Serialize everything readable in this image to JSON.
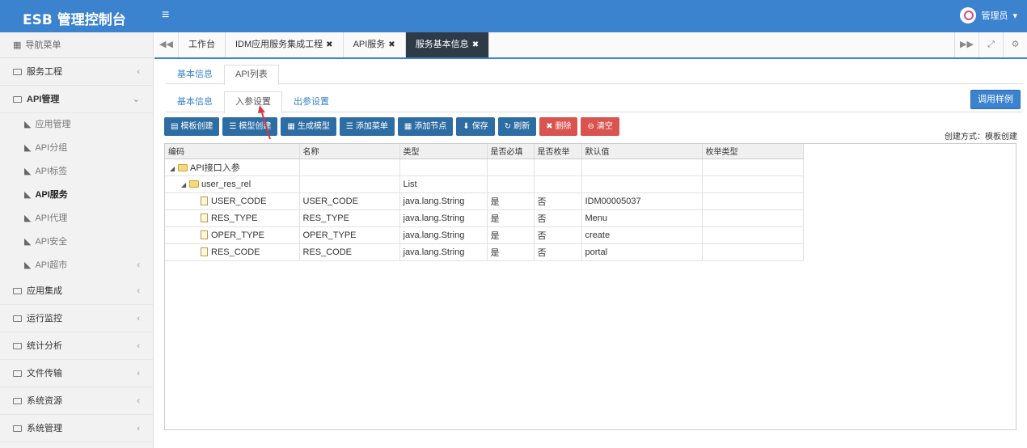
{
  "header": {
    "title": "ESB 管理控制台",
    "menu_icon": "hamburger-icon",
    "user_name": "管理员",
    "accent_color": "#3b82cf"
  },
  "sidebar": {
    "nav_title": "导航菜单",
    "groups": [
      {
        "label": "服务工程",
        "arrow": "‹"
      },
      {
        "label": "API管理",
        "arrow": "⌄",
        "open": true
      },
      {
        "label": "应用集成",
        "arrow": "‹"
      },
      {
        "label": "运行监控",
        "arrow": "‹"
      },
      {
        "label": "统计分析",
        "arrow": "‹"
      },
      {
        "label": "文件传输",
        "arrow": "‹"
      },
      {
        "label": "系统资源",
        "arrow": "‹"
      },
      {
        "label": "系统管理",
        "arrow": "‹"
      }
    ],
    "api_items": [
      {
        "label": "应用管理"
      },
      {
        "label": "API分组"
      },
      {
        "label": "API标签"
      },
      {
        "label": "API服务",
        "active": true
      },
      {
        "label": "API代理"
      },
      {
        "label": "API安全"
      },
      {
        "label": "API超市",
        "arrow": "‹"
      }
    ]
  },
  "page_tabs": [
    {
      "label": "工作台",
      "closable": false
    },
    {
      "label": "IDM应用服务集成工程",
      "closable": true
    },
    {
      "label": "API服务",
      "closable": true
    },
    {
      "label": "服务基本信息",
      "closable": true,
      "active": true
    }
  ],
  "tab_nav": {
    "prev": "◀◀",
    "next": "▶▶",
    "full": "⤢",
    "settings": "⚙"
  },
  "sub_tabs": [
    {
      "label": "基本信息"
    },
    {
      "label": "API列表",
      "active": true
    }
  ],
  "param_tabs": [
    {
      "label": "基本信息"
    },
    {
      "label": "入参设置",
      "active": true
    },
    {
      "label": "出参设置"
    }
  ],
  "example_button": "调用样例",
  "toolbar": [
    {
      "label": "模板创建",
      "icon": "▤",
      "color": "blue"
    },
    {
      "label": "模型创建",
      "icon": "☰",
      "color": "blue"
    },
    {
      "label": "生成模型",
      "icon": "▦",
      "color": "blue"
    },
    {
      "label": "添加菜单",
      "icon": "☰",
      "color": "blue"
    },
    {
      "label": "添加节点",
      "icon": "▦",
      "color": "blue"
    },
    {
      "label": "保存",
      "icon": "⬇",
      "color": "blue"
    },
    {
      "label": "刷新",
      "icon": "↻",
      "color": "blue"
    },
    {
      "label": "删除",
      "icon": "✖",
      "color": "red"
    },
    {
      "label": "清空",
      "icon": "⊖",
      "color": "red"
    }
  ],
  "create_mode": "创建方式：模板创建",
  "grid": {
    "columns": [
      "编码",
      "名称",
      "类型",
      "是否必填",
      "是否枚举",
      "默认值",
      "枚举类型"
    ],
    "rows": [
      {
        "level": 0,
        "kind": "folder",
        "expanded": true,
        "cells": [
          "API接口入参",
          "",
          "",
          "",
          "",
          "",
          ""
        ]
      },
      {
        "level": 1,
        "kind": "folder",
        "expanded": true,
        "cells": [
          "user_res_rel",
          "",
          "List",
          "",
          "",
          "",
          ""
        ]
      },
      {
        "level": 2,
        "kind": "file",
        "cells": [
          "USER_CODE",
          "USER_CODE",
          "java.lang.String",
          "是",
          "否",
          "IDM00005037",
          ""
        ]
      },
      {
        "level": 2,
        "kind": "file",
        "cells": [
          "RES_TYPE",
          "RES_TYPE",
          "java.lang.String",
          "是",
          "否",
          "Menu",
          ""
        ]
      },
      {
        "level": 2,
        "kind": "file",
        "cells": [
          "OPER_TYPE",
          "OPER_TYPE",
          "java.lang.String",
          "是",
          "否",
          "create",
          ""
        ]
      },
      {
        "level": 2,
        "kind": "file",
        "cells": [
          "RES_CODE",
          "RES_CODE",
          "java.lang.String",
          "是",
          "否",
          "portal",
          ""
        ]
      }
    ]
  }
}
